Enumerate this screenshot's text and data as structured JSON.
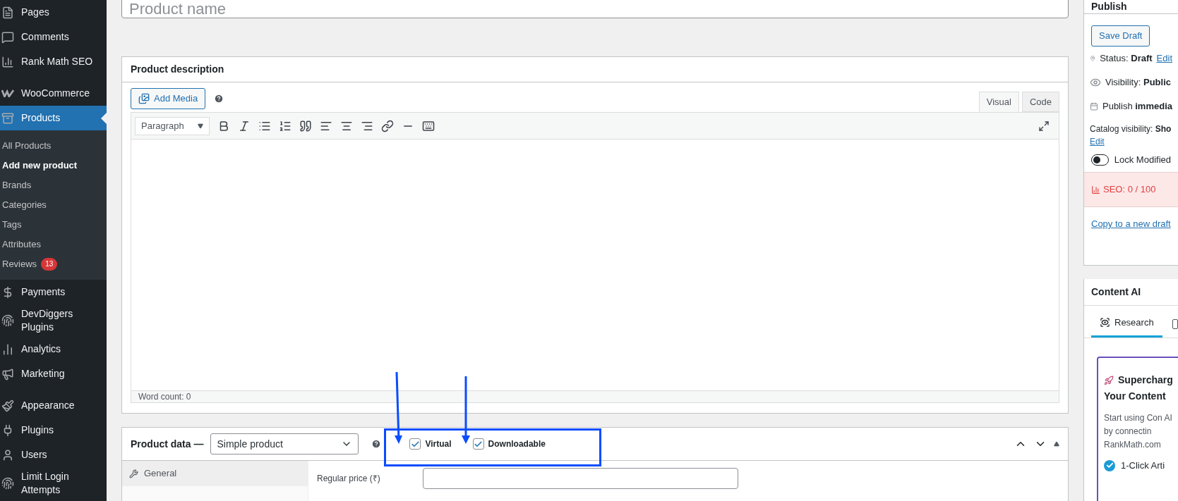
{
  "sidebar": {
    "items": [
      {
        "label": "Pages",
        "selected": false
      },
      {
        "label": "Comments",
        "selected": false
      },
      {
        "label": "Rank Math SEO",
        "selected": false
      },
      {
        "label": "WooCommerce",
        "selected": false
      },
      {
        "label": "Products",
        "selected": true,
        "children": [
          {
            "label": "All Products",
            "selected": false
          },
          {
            "label": "Add new product",
            "selected": true
          },
          {
            "label": "Brands",
            "selected": false
          },
          {
            "label": "Categories",
            "selected": false
          },
          {
            "label": "Tags",
            "selected": false
          },
          {
            "label": "Attributes",
            "selected": false
          },
          {
            "label": "Reviews",
            "selected": false,
            "badge": "13"
          }
        ]
      },
      {
        "label": "Payments",
        "selected": false
      },
      {
        "label": "DevDiggers Plugins",
        "selected": false
      },
      {
        "label": "Analytics",
        "selected": false
      },
      {
        "label": "Marketing",
        "selected": false
      },
      {
        "label": "Appearance",
        "selected": false
      },
      {
        "label": "Plugins",
        "selected": false
      },
      {
        "label": "Users",
        "selected": false
      },
      {
        "label": "Limit Login Attempts",
        "selected": false
      }
    ]
  },
  "title_field": {
    "placeholder": "Product name"
  },
  "description": {
    "title": "Product description",
    "add_media": "Add Media",
    "format_select": "Paragraph",
    "editor_tabs": [
      {
        "label": "Visual",
        "selected": true
      },
      {
        "label": "Code",
        "selected": false
      }
    ],
    "word_count": "Word count: 0"
  },
  "product_data": {
    "title": "Product data —",
    "type_select": "Simple product",
    "options": [
      {
        "label": "Virtual",
        "checked": true
      },
      {
        "label": "Downloadable",
        "checked": true
      }
    ],
    "tabs": [
      {
        "label": "General",
        "selected": true
      }
    ],
    "fields": [
      {
        "label": "Regular price (₹)"
      }
    ]
  },
  "publish": {
    "title": "Publish",
    "save_draft": "Save Draft",
    "rows": [
      {
        "kind": "status",
        "label": "Status:",
        "value": "Draft",
        "link": "Edit"
      },
      {
        "kind": "visibility",
        "label": "Visibility:",
        "value": "Public"
      },
      {
        "kind": "schedule",
        "label": "Publish",
        "value": "immedia"
      }
    ],
    "catalog": {
      "label": "Catalog visibility:",
      "value": "Sho",
      "link": "Edit"
    },
    "lock": {
      "label": "Lock Modified",
      "on": false
    },
    "seo": "SEO: 0 / 100",
    "copy_link": "Copy to a new draft"
  },
  "content_ai": {
    "title": "Content AI",
    "tabs": [
      {
        "label": "Research",
        "selected": true
      }
    ],
    "popup": {
      "title_lines": [
        "Supercharg",
        "Your Content"
      ],
      "body": "Start using Con AI by connectin RankMath.com",
      "features": [
        "1-Click Arti"
      ]
    }
  }
}
